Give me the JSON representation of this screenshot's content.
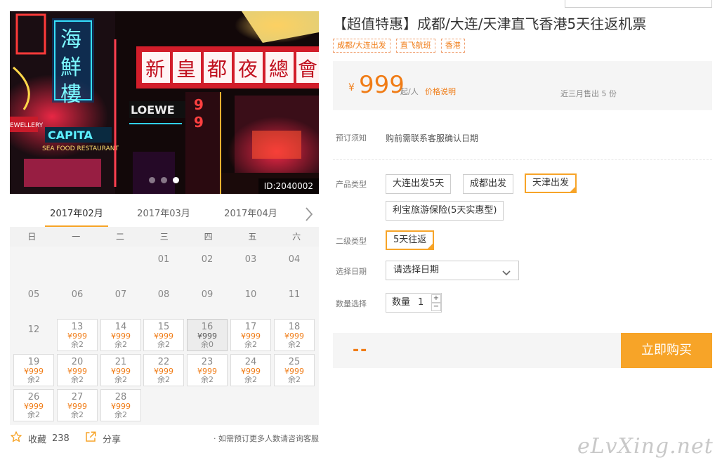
{
  "gallery": {
    "image_id": "ID:2040002",
    "sign_chars": [
      "新",
      "皇",
      "都",
      "夜",
      "總",
      "會"
    ],
    "sign_side_chars": [
      "海",
      "鮮",
      "樓"
    ],
    "sign_capita": "CAPITA",
    "sign_loewe": "LOEWE",
    "sign_seafood": "SEA FOOD RESTAURANT",
    "sign_jewellery": "EWELLERY"
  },
  "calendar": {
    "months": [
      "2017年02月",
      "2017年03月",
      "2017年04月"
    ],
    "weekdays": [
      "日",
      "一",
      "二",
      "三",
      "四",
      "五",
      "六"
    ],
    "plain_days": [
      "01",
      "02",
      "03",
      "04",
      "05",
      "06",
      "07",
      "08",
      "09",
      "10",
      "11",
      "12"
    ],
    "days": [
      {
        "d": "13",
        "p": "¥999",
        "r": "余2"
      },
      {
        "d": "14",
        "p": "¥999",
        "r": "余2"
      },
      {
        "d": "15",
        "p": "¥999",
        "r": "余2"
      },
      {
        "d": "16",
        "p": "¥999",
        "r": "余0"
      },
      {
        "d": "17",
        "p": "¥999",
        "r": "余2"
      },
      {
        "d": "18",
        "p": "¥999",
        "r": "余2"
      },
      {
        "d": "19",
        "p": "¥999",
        "r": "余2"
      },
      {
        "d": "20",
        "p": "¥999",
        "r": "余2"
      },
      {
        "d": "21",
        "p": "¥999",
        "r": "余2"
      },
      {
        "d": "22",
        "p": "¥999",
        "r": "余2"
      },
      {
        "d": "23",
        "p": "¥999",
        "r": "余2"
      },
      {
        "d": "24",
        "p": "¥999",
        "r": "余2"
      },
      {
        "d": "25",
        "p": "¥999",
        "r": "余2"
      },
      {
        "d": "26",
        "p": "¥999",
        "r": "余2"
      },
      {
        "d": "27",
        "p": "¥999",
        "r": "余2"
      },
      {
        "d": "28",
        "p": "¥999",
        "r": "余2"
      }
    ]
  },
  "actions": {
    "fav_label": "收藏",
    "fav_count": "238",
    "share_label": "分享",
    "note": "· 如需预订更多人数请咨询客服"
  },
  "product": {
    "title": "【超值特惠】成都/大连/天津直飞香港5天往返机票",
    "tags": [
      "成都/大连出发",
      "直飞航班",
      "香港"
    ],
    "currency": "¥",
    "price": "999",
    "price_unit": "起/人",
    "price_link": "价格说明",
    "sold": "近三月售出 5 份",
    "booking_label": "预订须知",
    "booking_text": "购前需联系客服确认日期",
    "type_label": "产品类型",
    "types": [
      "大连出发5天",
      "成都出发",
      "天津出发",
      "利宝旅游保险(5天实惠型)"
    ],
    "subtype_label": "二级类型",
    "subtypes": [
      "5天往返"
    ],
    "date_label": "选择日期",
    "date_placeholder": "请选择日期",
    "qty_label": "数量选择",
    "qty_inner_label": "数量",
    "qty_value": "1",
    "qty_plus": "+",
    "qty_minus": "−",
    "total": "--",
    "buy_label": "立即购买"
  },
  "watermark": "eLvXing.net"
}
